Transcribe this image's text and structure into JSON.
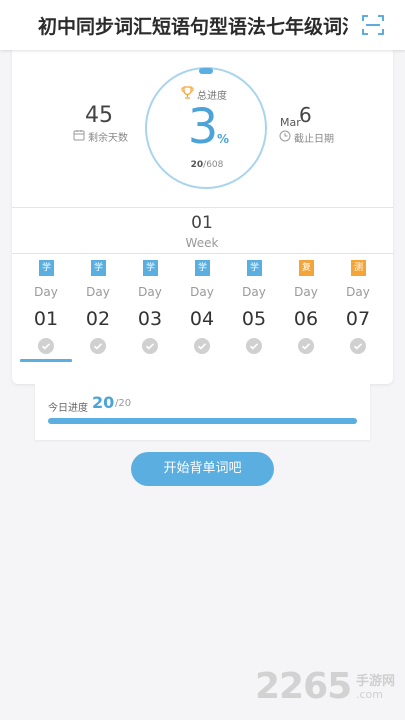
{
  "header": {
    "title": "初中同步词汇短语句型语法七年级词汇"
  },
  "overall": {
    "label": "总进度",
    "percent": "3",
    "percent_sign": "%",
    "learned": "20",
    "total": "/608",
    "ratio": 0.03
  },
  "days_left": {
    "value": "45",
    "label": "剩余天数"
  },
  "deadline": {
    "month": "Mar",
    "day": "6",
    "label": "截止日期"
  },
  "week": {
    "number": "01",
    "label": "Week"
  },
  "days": [
    {
      "badge": "学",
      "type": "learn",
      "label": "Day",
      "num": "01"
    },
    {
      "badge": "学",
      "type": "learn",
      "label": "Day",
      "num": "02"
    },
    {
      "badge": "学",
      "type": "learn",
      "label": "Day",
      "num": "03"
    },
    {
      "badge": "学",
      "type": "learn",
      "label": "Day",
      "num": "04"
    },
    {
      "badge": "学",
      "type": "learn",
      "label": "Day",
      "num": "05"
    },
    {
      "badge": "复",
      "type": "review",
      "label": "Day",
      "num": "06"
    },
    {
      "badge": "测",
      "type": "test",
      "label": "Day",
      "num": "07"
    }
  ],
  "today": {
    "label": "今日进度",
    "value": "20",
    "total": "/20",
    "ratio": 1.0
  },
  "start_button": {
    "label": "开始背单词吧"
  },
  "watermark": {
    "number": "2265",
    "text1": "手游网",
    "text2": ".com"
  },
  "colors": {
    "accent": "#5aaee0",
    "accent_text": "#4ba3d9",
    "review": "#f3a53a",
    "check": "#d0d0d0"
  }
}
